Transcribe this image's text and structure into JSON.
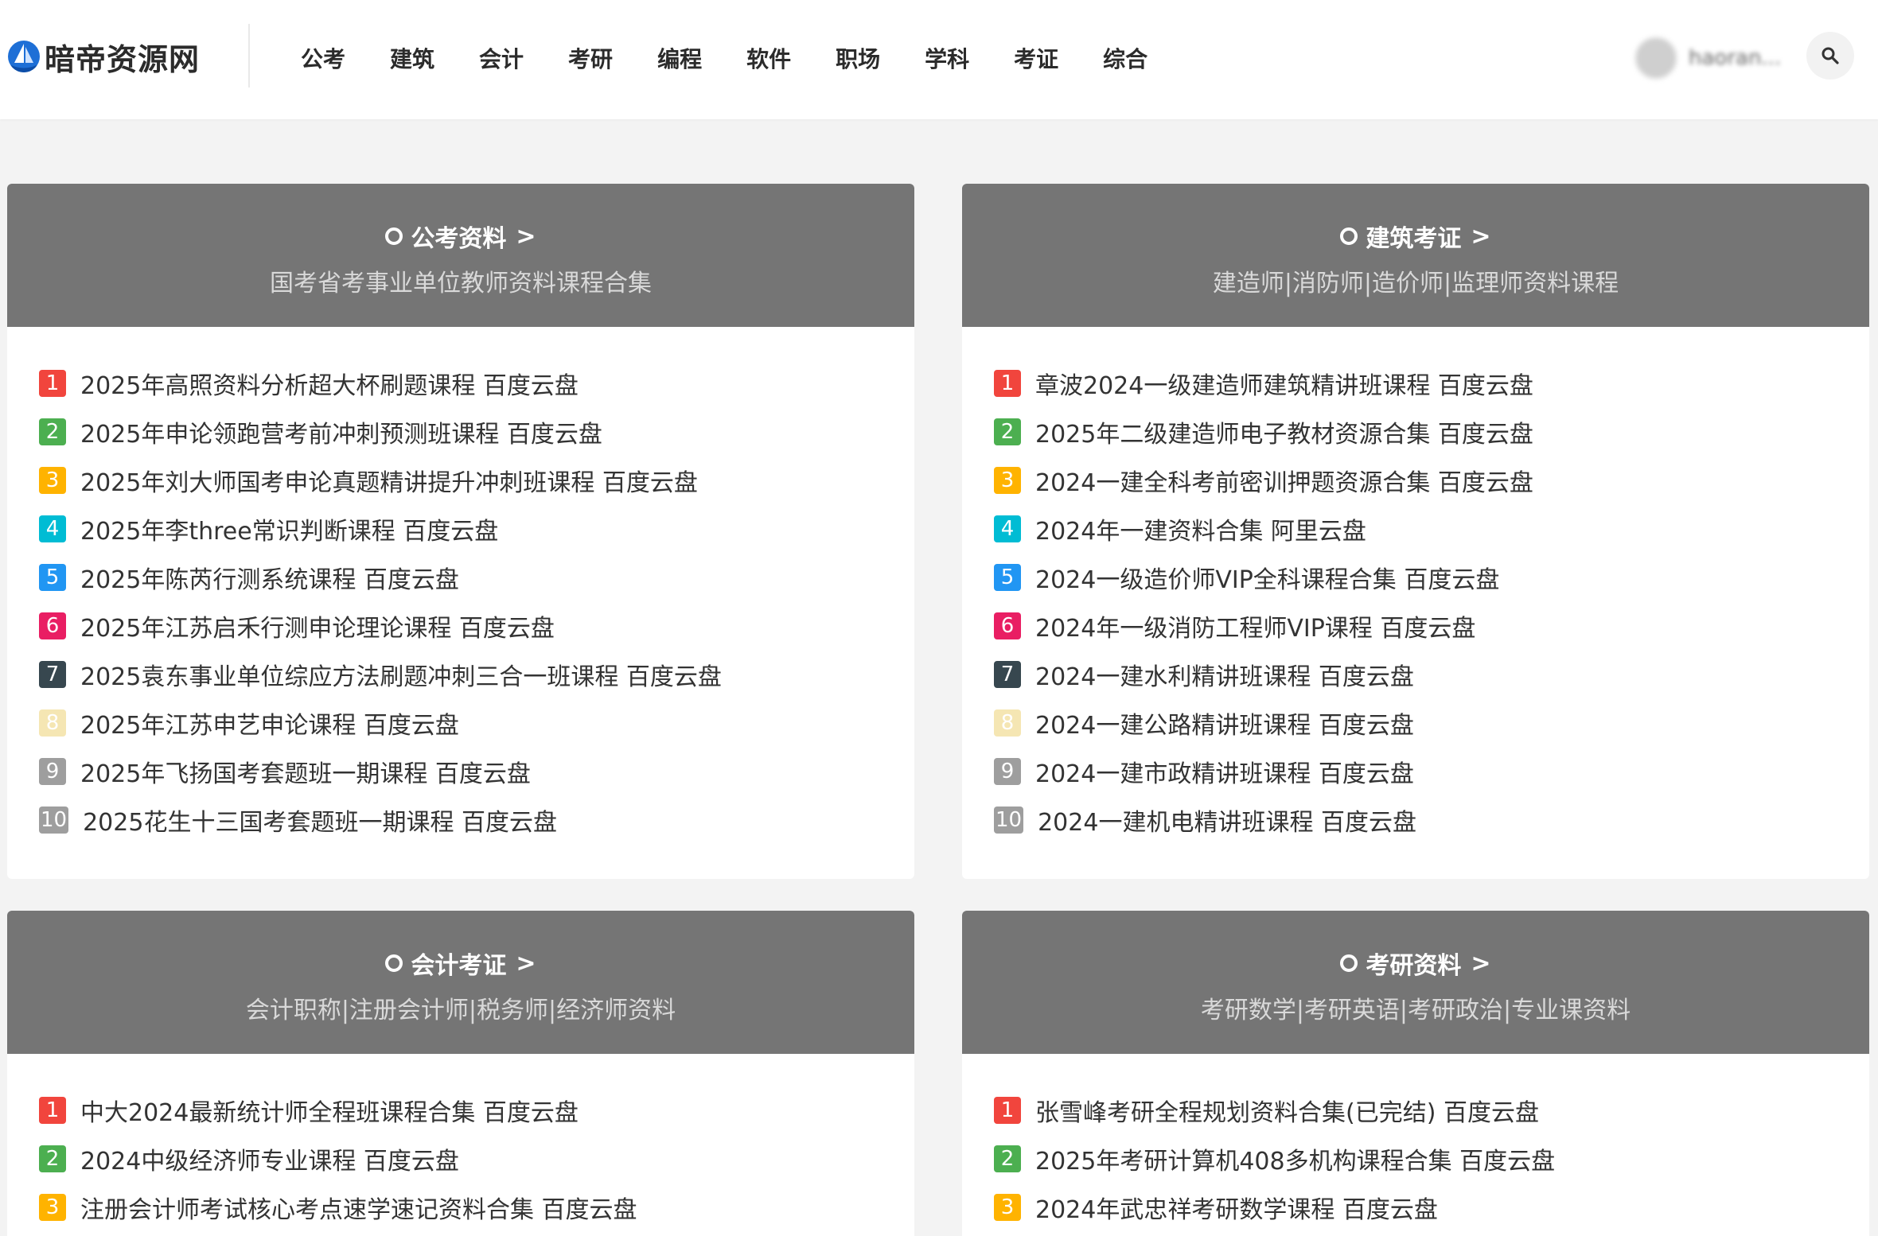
{
  "header": {
    "logo_text": "暗帝资源网",
    "nav": [
      "公考",
      "建筑",
      "会计",
      "考研",
      "编程",
      "软件",
      "职场",
      "学科",
      "考证",
      "综合"
    ],
    "user_name": "haoran..."
  },
  "colors": {
    "rank": [
      "#f1453d",
      "#4caf50",
      "#ffb300",
      "#00bcd4",
      "#2196f3",
      "#e91e63",
      "#37474f",
      "#f5e6b3",
      "#9e9e9e",
      "#9e9e9e"
    ],
    "card_header": "#757575",
    "logo_blue": "#1e6fd6"
  },
  "cards": [
    {
      "title": "公考资料",
      "subtitle": "国考省考事业单位教师资料课程合集",
      "items": [
        "2025年高照资料分析超大杯刷题课程 百度云盘",
        "2025年申论领跑营考前冲刺预测班课程 百度云盘",
        "2025年刘大师国考申论真题精讲提升冲刺班课程 百度云盘",
        "2025年李three常识判断课程 百度云盘",
        "2025年陈芮行测系统课程 百度云盘",
        "2025年江苏启禾行测申论理论课程 百度云盘",
        "2025袁东事业单位综应方法刷题冲刺三合一班课程 百度云盘",
        "2025年江苏申艺申论课程 百度云盘",
        "2025年飞扬国考套题班一期课程 百度云盘",
        "2025花生十三国考套题班一期课程 百度云盘"
      ]
    },
    {
      "title": "建筑考证",
      "subtitle": "建造师|消防师|造价师|监理师资料课程",
      "items": [
        "章波2024一级建造师建筑精讲班课程 百度云盘",
        "2025年二级建造师电子教材资源合集 百度云盘",
        "2024一建全科考前密训押题资源合集 百度云盘",
        "2024年一建资料合集 阿里云盘",
        "2024一级造价师VIP全科课程合集 百度云盘",
        "2024年一级消防工程师VIP课程 百度云盘",
        "2024一建水利精讲班课程 百度云盘",
        "2024一建公路精讲班课程 百度云盘",
        "2024一建市政精讲班课程 百度云盘",
        "2024一建机电精讲班课程 百度云盘"
      ]
    },
    {
      "title": "会计考证",
      "subtitle": "会计职称|注册会计师|税务师|经济师资料",
      "items": [
        "中大2024最新统计师全程班课程合集 百度云盘",
        "2024中级经济师专业课程 百度云盘",
        "注册会计师考试核心考点速学速记资料合集 百度云盘"
      ]
    },
    {
      "title": "考研资料",
      "subtitle": "考研数学|考研英语|考研政治|专业课资料",
      "items": [
        "张雪峰考研全程规划资料合集(已完结) 百度云盘",
        "2025年考研计算机408多机构课程合集 百度云盘",
        "2024年武忠祥考研数学课程 百度云盘"
      ]
    }
  ]
}
